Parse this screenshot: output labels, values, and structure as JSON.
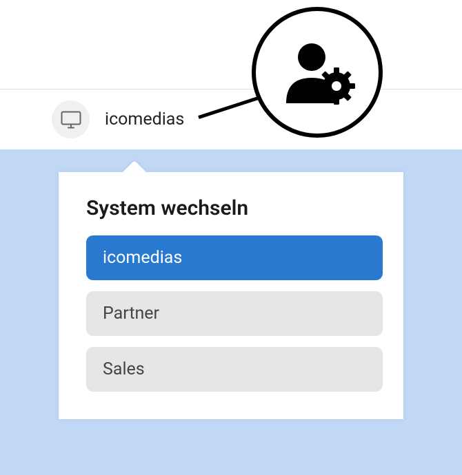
{
  "header": {
    "system_label": "icomedias"
  },
  "popup": {
    "title": "System wechseln",
    "options": [
      {
        "label": "icomedias",
        "selected": true
      },
      {
        "label": "Partner",
        "selected": false
      },
      {
        "label": "Sales",
        "selected": false
      }
    ]
  },
  "icons": {
    "monitor": "monitor-icon",
    "user_gear": "user-gear-icon"
  }
}
